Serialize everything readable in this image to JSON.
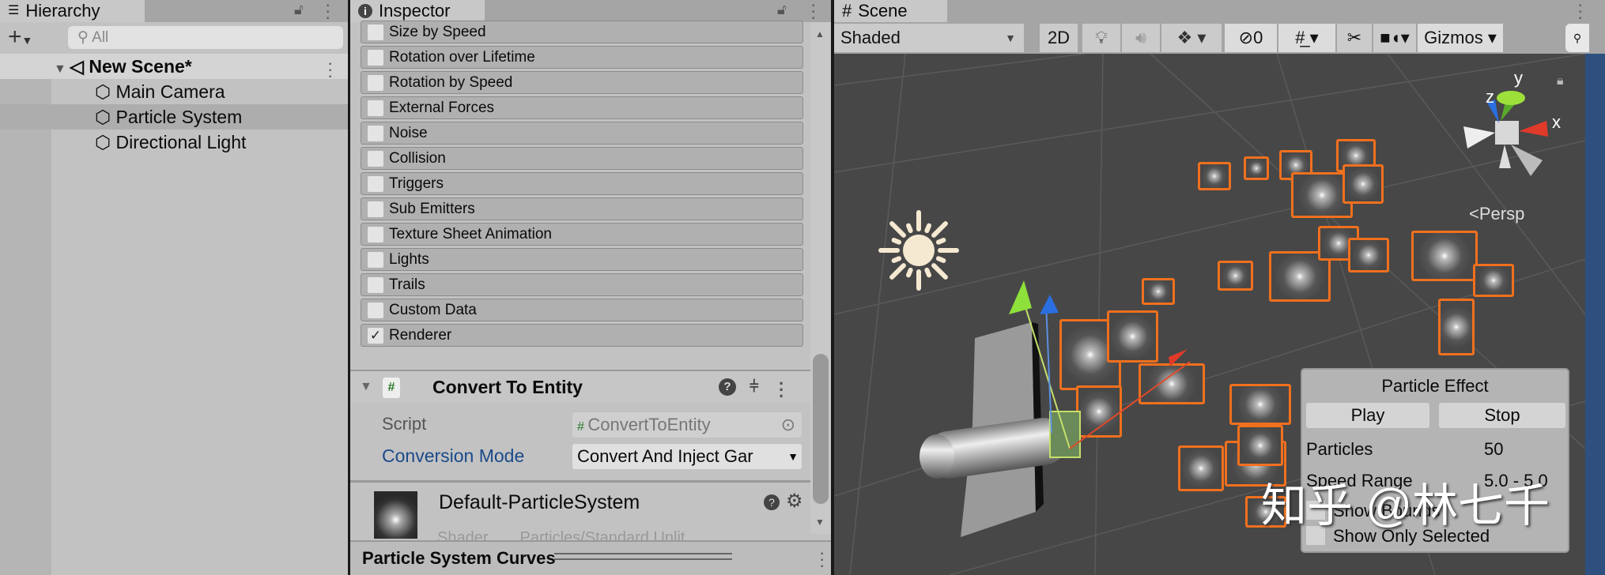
{
  "hierarchy": {
    "tab": "Hierarchy",
    "search_placeholder": "All",
    "scene": "New Scene*",
    "items": [
      "Main Camera",
      "Particle System",
      "Directional Light"
    ],
    "selected": "Particle System"
  },
  "inspector": {
    "tab": "Inspector",
    "modules": [
      {
        "label": "Size by Speed",
        "checked": false
      },
      {
        "label": "Rotation over Lifetime",
        "checked": false
      },
      {
        "label": "Rotation by Speed",
        "checked": false
      },
      {
        "label": "External Forces",
        "checked": false
      },
      {
        "label": "Noise",
        "checked": false
      },
      {
        "label": "Collision",
        "checked": false
      },
      {
        "label": "Triggers",
        "checked": false
      },
      {
        "label": "Sub Emitters",
        "checked": false
      },
      {
        "label": "Texture Sheet Animation",
        "checked": false
      },
      {
        "label": "Lights",
        "checked": false
      },
      {
        "label": "Trails",
        "checked": false
      },
      {
        "label": "Custom Data",
        "checked": false
      },
      {
        "label": "Renderer",
        "checked": true
      }
    ],
    "component": {
      "title": "Convert To Entity",
      "script_label": "Script",
      "script_value": "ConvertToEntity",
      "mode_label": "Conversion Mode",
      "mode_value": "Convert And Inject Gar"
    },
    "material": {
      "name": "Default-ParticleSystem",
      "shader_label": "Shader",
      "shader_value": "Particles/Standard Unlit"
    },
    "curves": "Particle System Curves"
  },
  "scene": {
    "tab": "Scene",
    "shading": "Shaded",
    "mode_2d": "2D",
    "hidden_count": "0",
    "gizmos": "Gizmos",
    "persp": "Persp",
    "axes": {
      "x": "x",
      "y": "y",
      "z": "z"
    },
    "accent": "#f0701e"
  },
  "overlay": {
    "title": "Particle Effect",
    "play": "Play",
    "stop": "Stop",
    "particles_label": "Particles",
    "particles_value": "50",
    "speed_label": "Speed Range",
    "speed_value": "5.0 - 5.0",
    "show_bounds": "Show Bounds",
    "show_only_selected": "Show Only Selected"
  },
  "watermark": "知乎 @林七千"
}
